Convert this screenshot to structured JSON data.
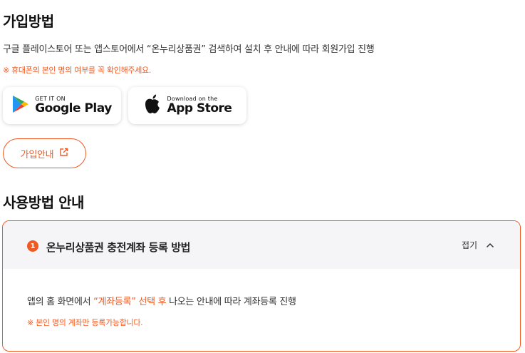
{
  "signup": {
    "title": "가입방법",
    "description": "구글 플레이스토어 또는 앱스토어에서 “온누리상품권” 검색하여 설치 후 안내에 따라 회원가입 진행",
    "note": "※ 휴대폰의 본인 명의 여부를 꼭 확인해주세요.",
    "google_play": {
      "small": "GET IT ON",
      "big": "Google Play",
      "icon": "google-play-icon"
    },
    "app_store": {
      "small": "Download on the",
      "big": "App Store",
      "icon": "apple-icon"
    },
    "guide_button": {
      "label": "가입안내",
      "icon": "external-link-icon"
    }
  },
  "usage": {
    "title": "사용방법 안내",
    "item": {
      "number": "1",
      "title": "온누리상품권 충전계좌 등록 방법",
      "collapse_label": "접기",
      "body_prefix": "앱의 홈 화면에서 ",
      "body_highlight": "“계좌등록” 선택 후",
      "body_suffix": " 나오는 안내에 따라 계좌등록 진행",
      "note": "※ 본인 명의 계좌만 등록가능합니다."
    }
  },
  "colors": {
    "accent": "#f05a22",
    "panel_bg": "#f5f5f7"
  }
}
